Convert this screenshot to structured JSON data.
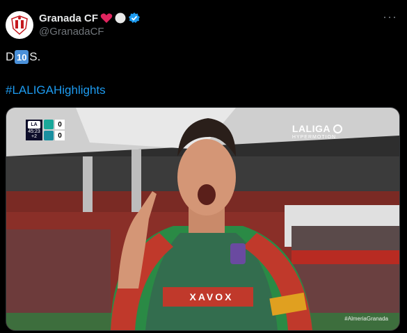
{
  "account": {
    "name": "Granada CF",
    "handle": "@GranadaCF",
    "badges": [
      "red-heart",
      "white-circle",
      "verified-badge"
    ]
  },
  "tweet": {
    "text_before": "D",
    "emoji_ten": "10",
    "text_after": "S.",
    "hashtag": "#LALIGAHighlights"
  },
  "media": {
    "scorebug": {
      "league": "LA",
      "time": "45:23",
      "added": "+2",
      "home_score": "0",
      "away_score": "0"
    },
    "broadcast": {
      "brand": "LALIGA",
      "sub": "HYPERMOTION"
    },
    "sponsor_text": "XAVOX",
    "clip_hashtag": "#AlmeriaGranada"
  },
  "colors": {
    "background": "#000000",
    "link": "#1d9bf0",
    "muted": "#71767b",
    "verified": "#1d9bf0",
    "kit_green": "#2a8a45",
    "kit_red": "#c0392b"
  }
}
